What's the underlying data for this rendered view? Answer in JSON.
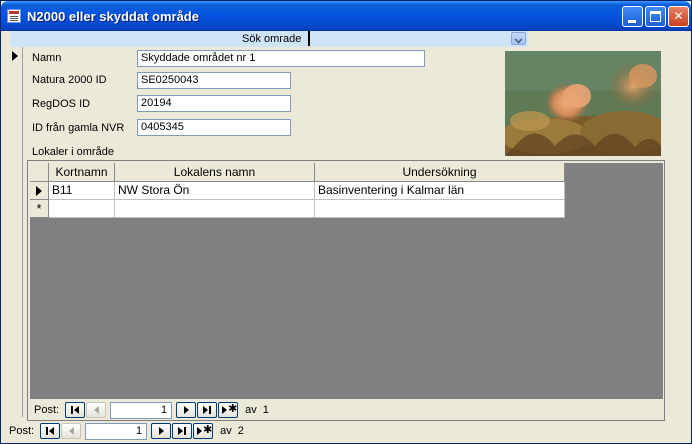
{
  "window": {
    "title": "N2000 eller skyddat område",
    "controls": [
      "minimize-icon",
      "maximize-icon",
      "close-icon"
    ]
  },
  "search": {
    "label": "Sök omrade",
    "value": ""
  },
  "fields": [
    {
      "label": "Namn",
      "value": "Skyddade området nr 1"
    },
    {
      "label": "Natura 2000 ID",
      "value": "SE0250043"
    },
    {
      "label": "RegDOS ID",
      "value": "20194"
    },
    {
      "label": "ID från gamla NVR",
      "value": "0405345"
    }
  ],
  "subform": {
    "label": "Lokaler i område",
    "columns": [
      "Kortnamn",
      "Lokalens namn",
      "Undersökning"
    ],
    "rows": [
      [
        "B11",
        "NW Stora Ön",
        "Basinventering i Kalmar län"
      ]
    ],
    "new_row_marker": "*"
  },
  "sub_nav": {
    "label": "Post:",
    "current": "1",
    "of_label": "av",
    "total": "1"
  },
  "main_nav": {
    "label": "Post:",
    "current": "1",
    "of_label": "av",
    "total": "2"
  },
  "colors": {
    "titlebar": "#0553e0",
    "form_bg": "#ece9d8",
    "search_strip": "#cfe4f7",
    "datasheet_bg": "#808080"
  }
}
